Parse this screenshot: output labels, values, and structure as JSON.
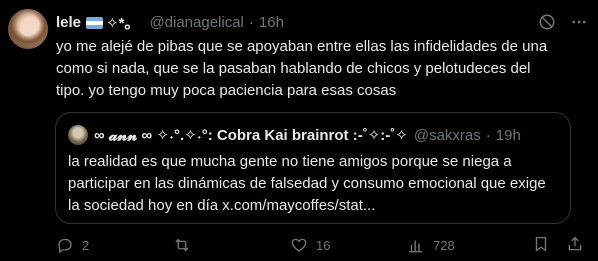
{
  "tweet": {
    "author_name": "lele",
    "author_emoji": "✧*。",
    "handle": "@dianagelical",
    "dot": "·",
    "time": "16h",
    "text": "yo me alejé de pibas que se apoyaban entre ellas las infidelidades de una\ncomo si nada, que se la pasaban hablando de chicos y pelotudeces del\ntipo. yo tengo muy poca paciencia para esas cosas"
  },
  "quote": {
    "author_name": "∞ 𝓪𝓷𝓷 ∞ ✧˖°.✧˖°: Cobra Kai brainrot :-˚✧:-˚✧",
    "handle": "@sakxras",
    "dot": "·",
    "time": "19h",
    "text": "la realidad es que mucha gente no tiene amigos porque se niega a\nparticipar en las dinámicas de falsedad y consumo emocional que exige\nla sociedad hoy en día x.com/maycoffes/stat..."
  },
  "actions": {
    "replies": "2",
    "reposts": "",
    "likes": "16",
    "views": "728"
  },
  "icons": {
    "mute": "mute-icon",
    "more": "more-icon",
    "reply": "reply-icon",
    "repost": "repost-icon",
    "like": "heart-icon",
    "views": "views-icon",
    "bookmark": "bookmark-icon",
    "share": "share-icon"
  },
  "colors": {
    "background": "#000000",
    "text": "#e7e9ea",
    "muted": "#71767b",
    "border": "#2f3336"
  }
}
